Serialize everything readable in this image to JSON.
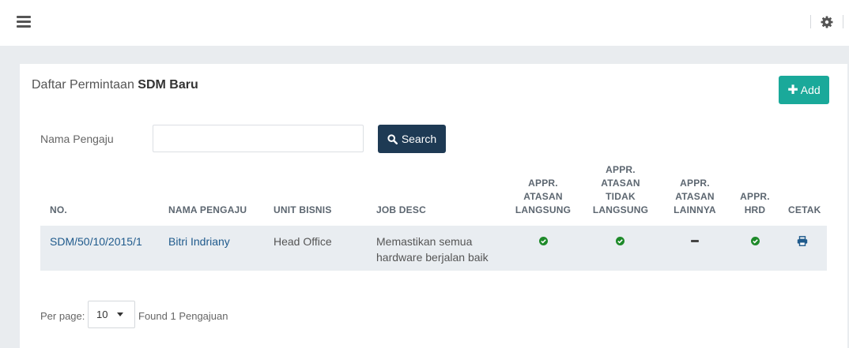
{
  "panel": {
    "title_prefix": "Daftar Permintaan ",
    "title_bold": "SDM Baru",
    "add_label": "Add"
  },
  "filter": {
    "label": "Nama Pengaju",
    "input_value": "",
    "search_label": "Search"
  },
  "table": {
    "headers": {
      "no": "NO.",
      "nama": "NAMA PENGAJU",
      "unit": "UNIT BISNIS",
      "job": "JOB DESC",
      "appr_langsung": [
        "APPR.",
        "ATASAN",
        "LANGSUNG"
      ],
      "appr_tidak": [
        "APPR.",
        "ATASAN",
        "TIDAK",
        "LANGSUNG"
      ],
      "appr_lainnya": [
        "APPR.",
        "ATASAN",
        "LAINNYA"
      ],
      "appr_hrd": [
        "APPR.",
        "HRD"
      ],
      "cetak": "CETAK"
    },
    "rows": [
      {
        "no": "SDM/50/10/2015/1",
        "nama": "Bitri Indriany",
        "unit": "Head Office",
        "job_line1": "Memastikan semua",
        "job_line2": "hardware berjalan baik",
        "appr_langsung": "check",
        "appr_tidak": "check",
        "appr_lainnya": "dash",
        "appr_hrd": "check"
      }
    ]
  },
  "pagination": {
    "per_page_label": "Per page:",
    "per_page_value": "10",
    "found_text": "Found 1 Pengajuan"
  },
  "colors": {
    "accent_add": "#1aa99a",
    "search_button": "#1e3a54",
    "check_green": "#1e8a2a",
    "link": "#1f5a8c"
  },
  "icons": [
    "menu-icon",
    "gear-icon",
    "plus-icon",
    "search-icon",
    "check-icon",
    "dash-icon",
    "printer-icon",
    "caret-down-icon"
  ]
}
